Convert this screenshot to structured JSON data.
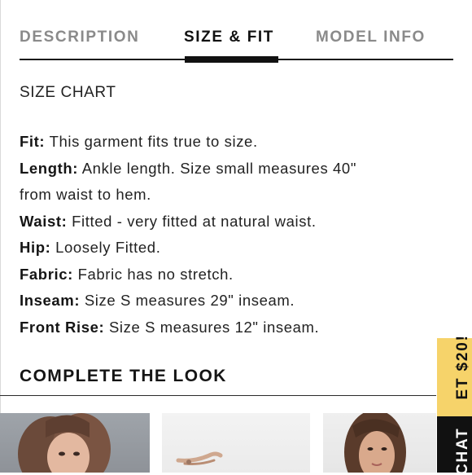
{
  "tabs": {
    "description": "DESCRIPTION",
    "size_fit": "SIZE & FIT",
    "model_info": "MODEL INFO",
    "active": "SIZE & FIT"
  },
  "size_chart_label": "SIZE CHART",
  "specs": [
    {
      "label": "Fit:",
      "value": " This garment fits true to size."
    },
    {
      "label": "Length:",
      "value": " Ankle length. Size small measures 40\""
    },
    {
      "label": "",
      "value": "from waist to hem."
    },
    {
      "label": "Waist:",
      "value": " Fitted - very fitted at natural waist."
    },
    {
      "label": "Hip:",
      "value": " Loosely Fitted."
    },
    {
      "label": "Fabric:",
      "value": " Fabric has no stretch."
    },
    {
      "label": "Inseam:",
      "value": " Size S measures 29\" inseam."
    },
    {
      "label": "Front Rise:",
      "value": " Size S measures 12\" inseam."
    }
  ],
  "complete_the_look": "COMPLETE THE LOOK",
  "chat_tab": {
    "dark_text": "CHAT",
    "light_text": "ET $20!"
  },
  "colors": {
    "accent_yellow": "#f6d36a",
    "text_dark": "#111111",
    "tab_inactive": "#8a8a8a"
  }
}
